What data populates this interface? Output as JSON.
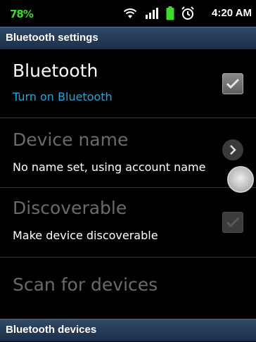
{
  "status_bar": {
    "battery_percent": "78%",
    "time": "4:20 AM",
    "icons": [
      "wifi-icon",
      "signal-icon",
      "battery-icon",
      "alarm-icon"
    ]
  },
  "header": {
    "title": "Bluetooth settings"
  },
  "settings": {
    "bluetooth": {
      "title": "Bluetooth",
      "summary": "Turn on Bluetooth",
      "checked": true
    },
    "device_name": {
      "title": "Device name",
      "summary": "No name set, using account name"
    },
    "discoverable": {
      "title": "Discoverable",
      "summary": "Make device discoverable",
      "checked": false
    },
    "scan": {
      "title": "Scan for devices"
    }
  },
  "devices_header": {
    "title": "Bluetooth devices"
  },
  "colors": {
    "accent": "#1aa9e0",
    "battery_text": "#3ddc2a",
    "disabled_text": "#6a6a6a"
  }
}
